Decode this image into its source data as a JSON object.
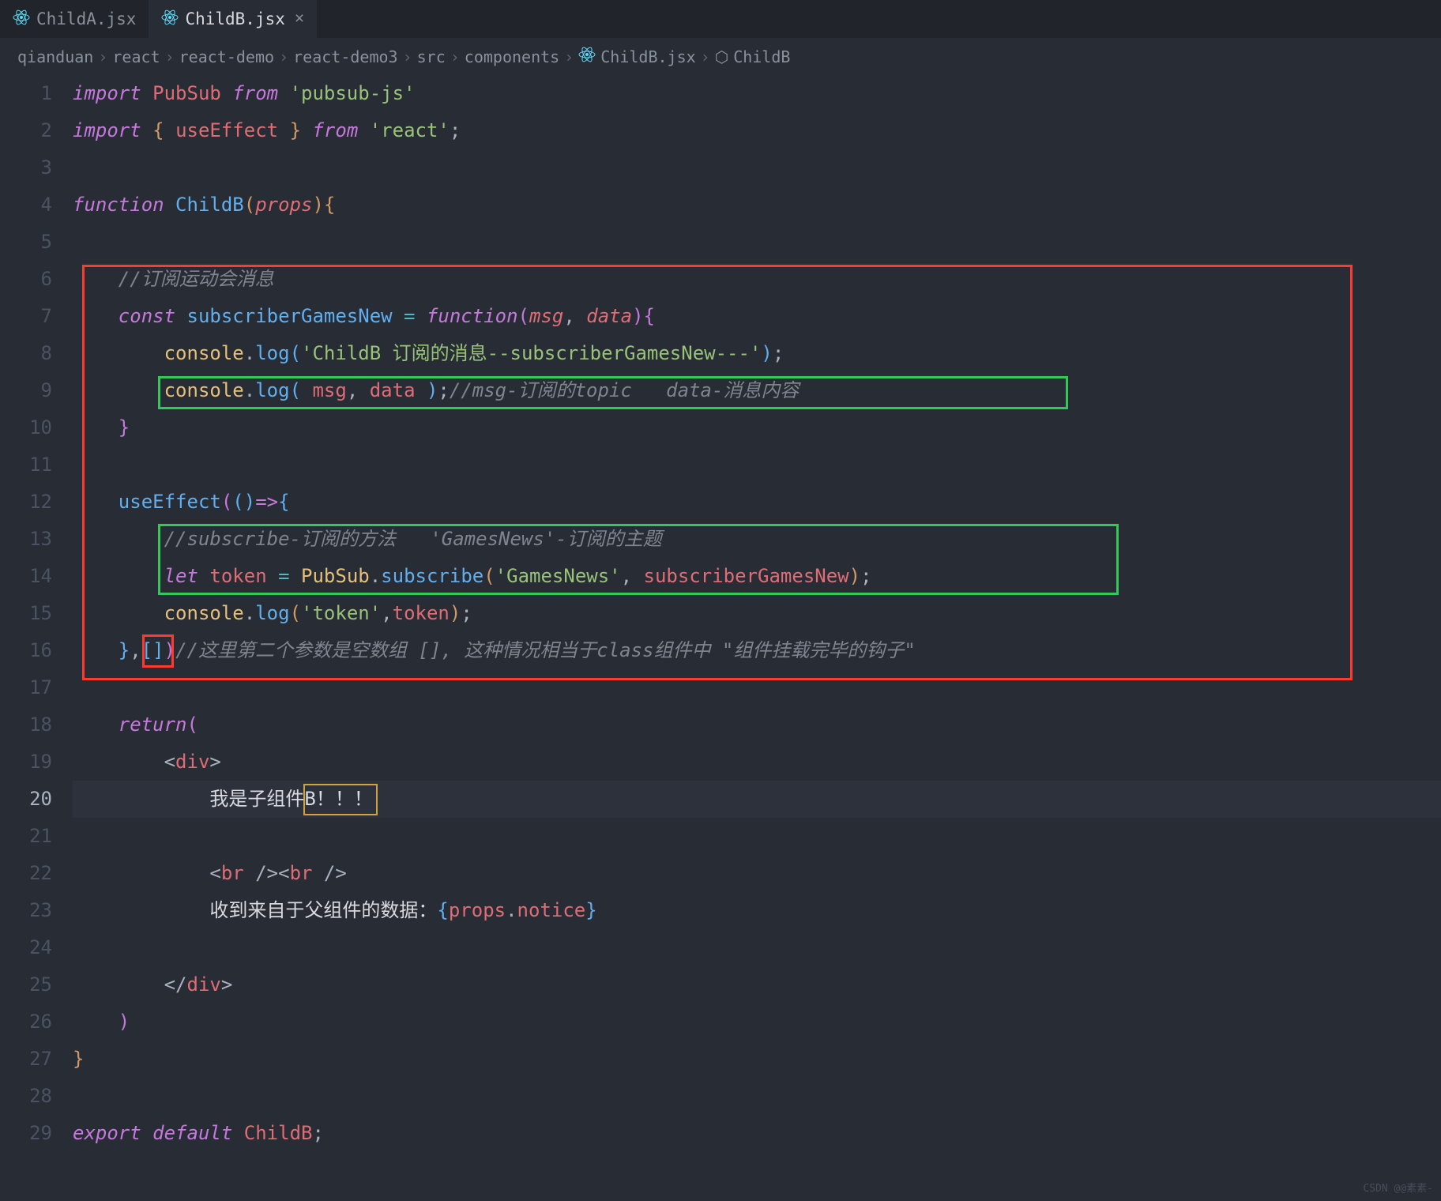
{
  "tabs": [
    {
      "label": "ChildA.jsx",
      "active": false,
      "close": ""
    },
    {
      "label": "ChildB.jsx",
      "active": true,
      "close": "×"
    }
  ],
  "breadcrumb": {
    "sep": "›",
    "items": [
      "qianduan",
      "react",
      "react-demo",
      "react-demo3",
      "src",
      "components",
      "ChildB.jsx",
      "ChildB"
    ]
  },
  "gutter": {
    "lines": [
      "1",
      "2",
      "3",
      "4",
      "5",
      "6",
      "7",
      "8",
      "9",
      "10",
      "11",
      "12",
      "13",
      "14",
      "15",
      "16",
      "17",
      "18",
      "19",
      "20",
      "21",
      "22",
      "23",
      "24",
      "25",
      "26",
      "27",
      "28",
      "29"
    ],
    "current": 20
  },
  "code": {
    "l1": {
      "a": "import",
      "b": "PubSub",
      "c": "from",
      "d": "'pubsub-js'"
    },
    "l2": {
      "a": "import",
      "b": "{",
      "c": "useEffect",
      "d": "}",
      "e": "from",
      "f": "'react'",
      "g": ";"
    },
    "l4": {
      "a": "function",
      "b": "ChildB",
      "c": "(",
      "d": "props",
      "e": ")",
      "f": "{"
    },
    "l6": {
      "cmt": "//订阅运动会消息"
    },
    "l7": {
      "a": "const",
      "b": "subscriberGamesNew",
      "c": "=",
      "d": "function",
      "e": "(",
      "f": "msg",
      "g": ",",
      "h": "data",
      "i": ")",
      "j": "{"
    },
    "l8": {
      "a": "console",
      "b": ".",
      "c": "log",
      "d": "(",
      "e": "'ChildB 订阅的消息--subscriberGamesNew---'",
      "f": ")",
      "g": ";"
    },
    "l9": {
      "a": "console",
      "b": ".",
      "c": "log",
      "d": "(",
      "e": " msg",
      "f": ",",
      "g": " data ",
      "h": ")",
      "i": ";",
      "cmt": "//msg-订阅的topic   data-消息内容"
    },
    "l10": {
      "a": "}"
    },
    "l12": {
      "a": "useEffect",
      "b": "(",
      "c": "(",
      "d": ")",
      "e": "=>",
      "f": "{"
    },
    "l13": {
      "cmt": "//subscribe-订阅的方法   'GamesNews'-订阅的主题"
    },
    "l14": {
      "a": "let",
      "b": "token",
      "c": "=",
      "d": "PubSub",
      "e": ".",
      "f": "subscribe",
      "g": "(",
      "h": "'GamesNews'",
      "i": ",",
      "j": " subscriberGamesNew",
      "k": ")",
      "l": ";"
    },
    "l15": {
      "a": "console",
      "b": ".",
      "c": "log",
      "d": "(",
      "e": "'token'",
      "f": ",",
      "g": "token",
      "h": ")",
      "i": ";"
    },
    "l16": {
      "a": "}",
      "b": ",",
      "c": "[",
      "d": "]",
      "e": ")",
      "cmt": "//这里第二个参数是空数组 [], 这种情况相当于class组件中 \"组件挂载完毕的钩子\""
    },
    "l18": {
      "a": "return",
      "b": "("
    },
    "l19": {
      "a": "<",
      "b": "div",
      "c": ">"
    },
    "l20": {
      "a": "我是子组件B！！！"
    },
    "l22": {
      "a": "<",
      "b": "br",
      "c": " />",
      "d": "<",
      "e": "br",
      "f": " />"
    },
    "l23": {
      "a": "收到来自于父组件的数据：",
      "b": "{",
      "c": "props",
      "d": ".",
      "e": "notice",
      "f": "}"
    },
    "l25": {
      "a": "</",
      "b": "div",
      "c": ">"
    },
    "l26": {
      "a": ")"
    },
    "l27": {
      "a": "}"
    },
    "l29": {
      "a": "export",
      "b": "default",
      "c": "ChildB",
      "d": ";"
    }
  },
  "watermark": "CSDN @@素素-"
}
